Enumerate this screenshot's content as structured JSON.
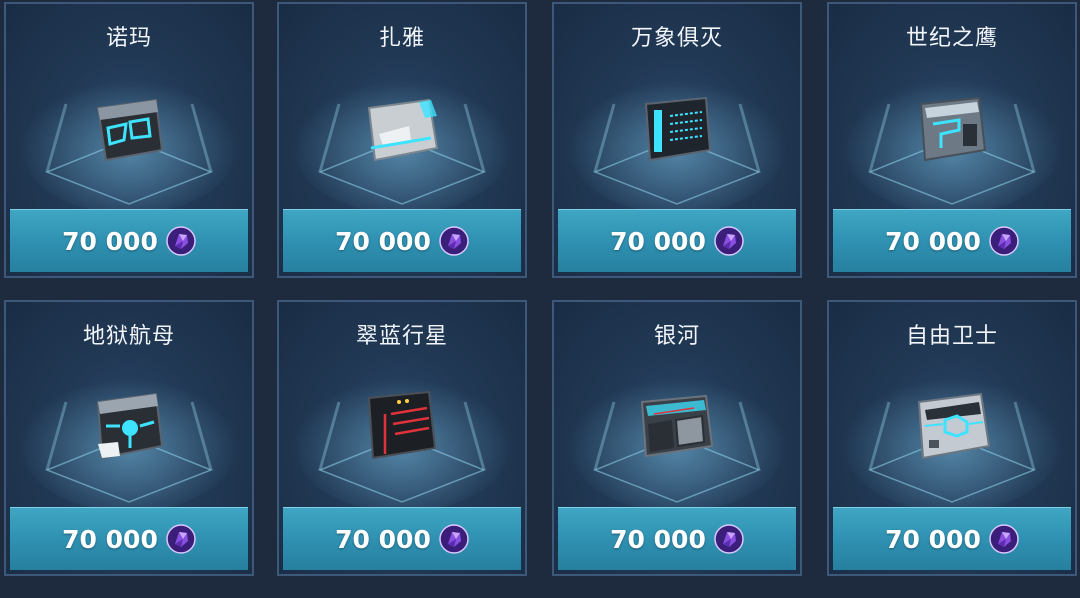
{
  "currency_icon": "crystal-gem-icon",
  "colors": {
    "card_bg": "#213955",
    "price_bar": "#2e8fb0",
    "gem": "#7b3fd0",
    "accent_cyan": "#3de3ff",
    "accent_red": "#e0323a"
  },
  "items": [
    {
      "name": "诺玛",
      "price": "70 000",
      "accent": "cyan"
    },
    {
      "name": "扎雅",
      "price": "70 000",
      "accent": "cyan"
    },
    {
      "name": "万象俱灭",
      "price": "70 000",
      "accent": "cyan"
    },
    {
      "name": "世纪之鹰",
      "price": "70 000",
      "accent": "cyan"
    },
    {
      "name": "地狱航母",
      "price": "70 000",
      "accent": "cyan"
    },
    {
      "name": "翠蓝行星",
      "price": "70 000",
      "accent": "red"
    },
    {
      "name": "银河",
      "price": "70 000",
      "accent": "cyan"
    },
    {
      "name": "自由卫士",
      "price": "70 000",
      "accent": "cyan"
    }
  ]
}
